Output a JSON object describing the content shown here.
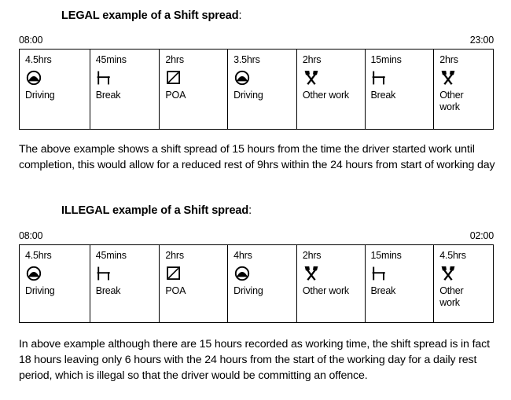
{
  "document": {
    "legal_section": {
      "heading_text": "LEGAL example of a Shift spread",
      "heading_colon": ":",
      "start_time": "08:00",
      "end_time": "23:00",
      "cells": [
        {
          "duration": "4.5hrs",
          "icon": "driving-icon",
          "label": "Driving"
        },
        {
          "duration": "45mins",
          "icon": "break-icon",
          "label": "Break"
        },
        {
          "duration": "2hrs",
          "icon": "poa-icon",
          "label": "POA"
        },
        {
          "duration": "3.5hrs",
          "icon": "driving-icon",
          "label": "Driving"
        },
        {
          "duration": "2hrs",
          "icon": "other-work-icon",
          "label": "Other work"
        },
        {
          "duration": "15mins",
          "icon": "break-icon",
          "label": "Break"
        },
        {
          "duration": "2hrs",
          "icon": "other-work-icon",
          "label": "Other work"
        }
      ],
      "paragraph": "The above example shows a shift spread of 15 hours from the time the driver started work until completion, this would allow for a reduced rest of 9hrs within the 24 hours from start of working day"
    },
    "illegal_section": {
      "heading_text": "ILLEGAL example of a Shift spread",
      "heading_colon": ":",
      "start_time": "08:00",
      "end_time": "02:00",
      "cells": [
        {
          "duration": "4.5hrs",
          "icon": "driving-icon",
          "label": "Driving"
        },
        {
          "duration": "45mins",
          "icon": "break-icon",
          "label": "Break"
        },
        {
          "duration": "2hrs",
          "icon": "poa-icon",
          "label": "POA"
        },
        {
          "duration": "4hrs",
          "icon": "driving-icon",
          "label": "Driving"
        },
        {
          "duration": "2hrs",
          "icon": "other-work-icon",
          "label": "Other work"
        },
        {
          "duration": "15mins",
          "icon": "break-icon",
          "label": "Break"
        },
        {
          "duration": "4.5hrs",
          "icon": "other-work-icon",
          "label": "Other work"
        }
      ],
      "paragraph": "In above example although there are 15 hours recorded as working time, the shift spread is in fact 18 hours leaving only 6 hours with the 24 hours from the start of the working day for a daily rest period, which is illegal so that the driver would be committing an offence."
    },
    "colors": {
      "text": "#000000",
      "background": "#ffffff",
      "border": "#000000"
    }
  }
}
